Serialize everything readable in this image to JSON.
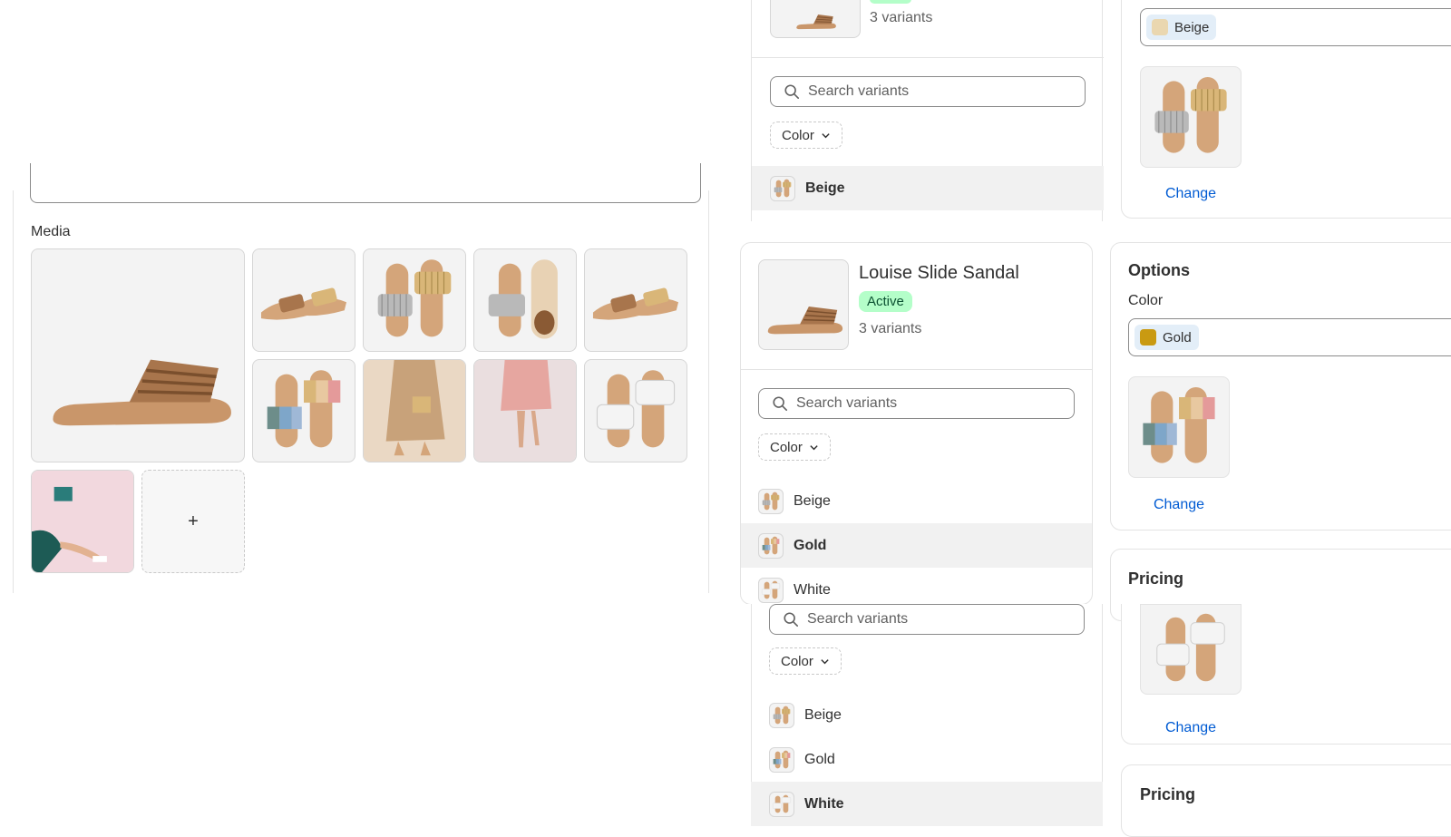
{
  "media": {
    "label": "Media",
    "add_icon": "+"
  },
  "top_variants_panel": {
    "variant_count": "3 variants",
    "search_placeholder": "Search variants",
    "filter_label": "Color",
    "rows": [
      {
        "label": "Beige",
        "selected": true
      }
    ]
  },
  "top_option_panel": {
    "selected_value": "Beige",
    "swatch_color": "#ead7b0",
    "change_label": "Change"
  },
  "product_card": {
    "title": "Louise Slide Sandal",
    "status": "Active",
    "variant_count": "3 variants",
    "search_placeholder": "Search variants",
    "filter_label": "Color",
    "rows": [
      {
        "label": "Beige",
        "selected": false
      },
      {
        "label": "Gold",
        "selected": true
      },
      {
        "label": "White",
        "selected": false
      }
    ]
  },
  "options_card": {
    "title": "Options",
    "color_label": "Color",
    "selected_value": "Gold",
    "swatch_color": "#c99a12",
    "change_label": "Change"
  },
  "pricing_card": {
    "title": "Pricing"
  },
  "bottom_variants_panel": {
    "search_placeholder": "Search variants",
    "filter_label": "Color",
    "rows": [
      {
        "label": "Beige",
        "selected": false
      },
      {
        "label": "Gold",
        "selected": false
      },
      {
        "label": "White",
        "selected": true
      }
    ]
  },
  "bottom_option_panel": {
    "change_label": "Change"
  },
  "bottom_pricing_card": {
    "title": "Pricing"
  },
  "colors": {
    "accent_link": "#005bd3",
    "active_badge_bg": "#b4fec9",
    "active_badge_text": "#0c5132",
    "selected_row_bg": "#f1f1f1"
  }
}
